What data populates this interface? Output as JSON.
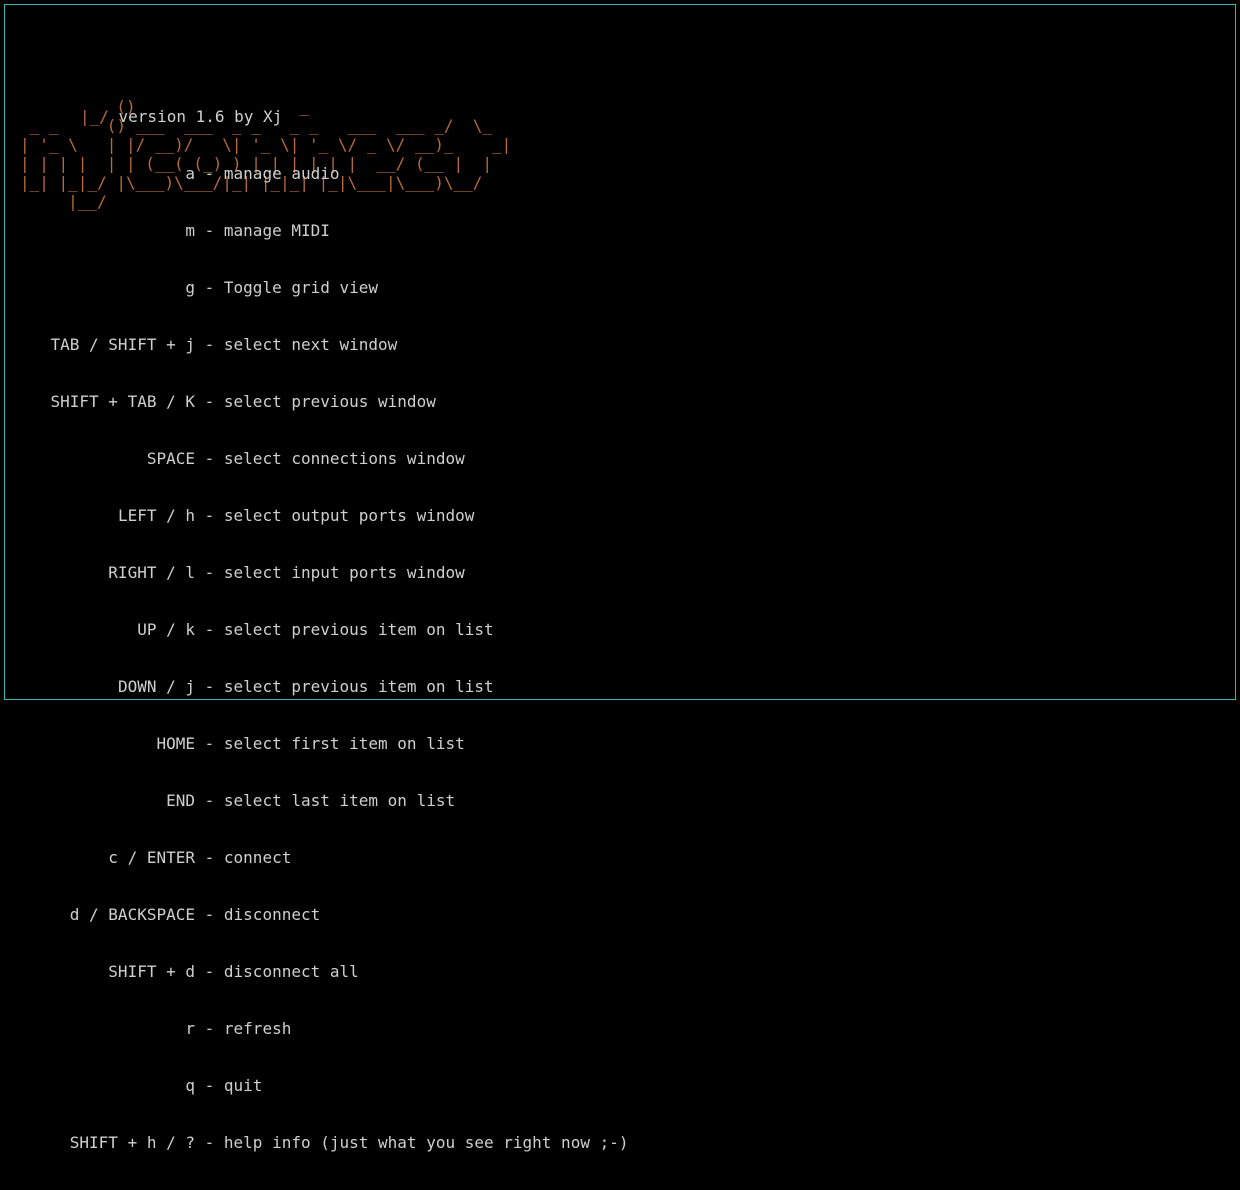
{
  "ascii_art": "          ()                 _\n _ _     () ___  ___  _ _   _ _   ___  ___ _/  \\_\n| '_ \\   | |/ __)/   \\| '_ \\| '_ \\/ _ \\/ __)_    _|\n| | | |  | | (__( (_) ) | | | | | |  __/ (__ |  |\n|_| |_|_/ |\\___)\\___/|_| |_|_| |_|\\___|\\___)\\__/\n     |__/",
  "version_prefix": "|_/ ",
  "version_text": "version 1.6 by Xj",
  "help": [
    {
      "key": "a",
      "desc": "manage audio"
    },
    {
      "key": "m",
      "desc": "manage MIDI"
    },
    {
      "key": "g",
      "desc": "Toggle grid view"
    },
    {
      "key": "TAB / SHIFT + j",
      "desc": "select next window"
    },
    {
      "key": "SHIFT + TAB / K",
      "desc": "select previous window"
    },
    {
      "key": "SPACE",
      "desc": "select connections window"
    },
    {
      "key": "LEFT / h",
      "desc": "select output ports window"
    },
    {
      "key": "RIGHT / l",
      "desc": "select input ports window"
    },
    {
      "key": "UP / k",
      "desc": "select previous item on list"
    },
    {
      "key": "DOWN / j",
      "desc": "select previous item on list"
    },
    {
      "key": "HOME",
      "desc": "select first item on list"
    },
    {
      "key": "END",
      "desc": "select last item on list"
    },
    {
      "key": "c / ENTER",
      "desc": "connect"
    },
    {
      "key": "d / BACKSPACE",
      "desc": "disconnect"
    },
    {
      "key": "SHIFT + d",
      "desc": "disconnect all"
    },
    {
      "key": "r",
      "desc": "refresh"
    },
    {
      "key": "q",
      "desc": "quit"
    },
    {
      "key": "SHIFT + h / ?",
      "desc": "help info (just what you see right now ;-)"
    }
  ],
  "separator": " - "
}
